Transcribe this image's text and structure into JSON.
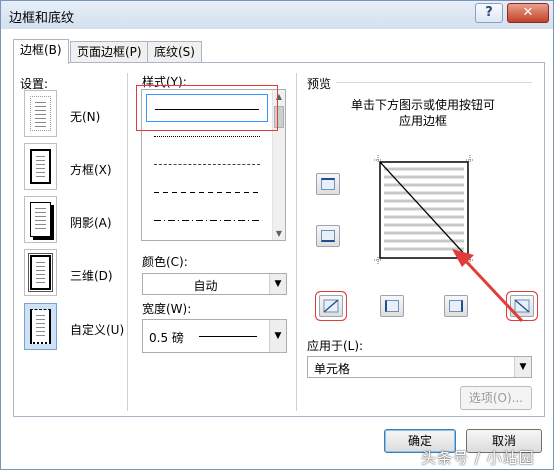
{
  "window": {
    "title": "边框和底纹",
    "help_label": "?",
    "close_label": "✕"
  },
  "tabs": [
    {
      "label": "边框(B)"
    },
    {
      "label": "页面边框(P)"
    },
    {
      "label": "底纹(S)"
    }
  ],
  "settings": {
    "label": "设置:",
    "items": [
      {
        "label": "无(N)"
      },
      {
        "label": "方框(X)"
      },
      {
        "label": "阴影(A)"
      },
      {
        "label": "三维(D)"
      },
      {
        "label": "自定义(U)"
      }
    ]
  },
  "style": {
    "label": "样式(Y):"
  },
  "color": {
    "label": "颜色(C):",
    "value": "自动"
  },
  "width": {
    "label": "宽度(W):",
    "value": "0.5 磅"
  },
  "preview": {
    "label": "预览",
    "hint_line1": "单击下方图示或使用按钮可",
    "hint_line2": "应用边框"
  },
  "apply_to": {
    "label": "应用于(L):",
    "value": "单元格"
  },
  "options_button": "选项(O)...",
  "ok_button": "确定",
  "cancel_button": "取消",
  "watermark": "头条号 / 小站园",
  "colors": {
    "annotation_red": "#e23b3b",
    "selection_blue": "#cde2f7"
  }
}
